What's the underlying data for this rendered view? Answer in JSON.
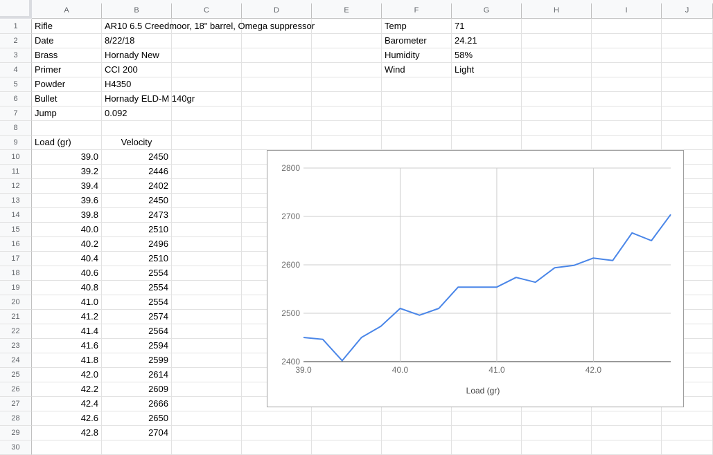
{
  "columns": [
    "A",
    "B",
    "C",
    "D",
    "E",
    "F",
    "G",
    "H",
    "I",
    "J"
  ],
  "rows": [
    "1",
    "2",
    "3",
    "4",
    "5",
    "6",
    "7",
    "8",
    "9",
    "10",
    "11",
    "12",
    "13",
    "14",
    "15",
    "16",
    "17",
    "18",
    "19",
    "20",
    "21",
    "22",
    "23",
    "24",
    "25",
    "26",
    "27",
    "28",
    "29",
    "30"
  ],
  "info": [
    {
      "label": "Rifle",
      "value": "AR10 6.5 Creedmoor, 18\" barrel, Omega suppressor"
    },
    {
      "label": "Date",
      "value": "8/22/18"
    },
    {
      "label": "Brass",
      "value": "Hornady New"
    },
    {
      "label": "Primer",
      "value": "CCI 200"
    },
    {
      "label": "Powder",
      "value": "H4350"
    },
    {
      "label": "Bullet",
      "value": "Hornady ELD-M 140gr"
    },
    {
      "label": "Jump",
      "value": "0.092"
    }
  ],
  "conditions": [
    {
      "label": "Temp",
      "value": "71"
    },
    {
      "label": "Barometer",
      "value": "24.21"
    },
    {
      "label": "Humidity",
      "value": "58%"
    },
    {
      "label": "Wind",
      "value": "Light"
    }
  ],
  "table": {
    "headers": [
      "Load (gr)",
      "Velocity"
    ],
    "rows": [
      [
        "39.0",
        "2450"
      ],
      [
        "39.2",
        "2446"
      ],
      [
        "39.4",
        "2402"
      ],
      [
        "39.6",
        "2450"
      ],
      [
        "39.8",
        "2473"
      ],
      [
        "40.0",
        "2510"
      ],
      [
        "40.2",
        "2496"
      ],
      [
        "40.4",
        "2510"
      ],
      [
        "40.6",
        "2554"
      ],
      [
        "40.8",
        "2554"
      ],
      [
        "41.0",
        "2554"
      ],
      [
        "41.2",
        "2574"
      ],
      [
        "41.4",
        "2564"
      ],
      [
        "41.6",
        "2594"
      ],
      [
        "41.8",
        "2599"
      ],
      [
        "42.0",
        "2614"
      ],
      [
        "42.2",
        "2609"
      ],
      [
        "42.4",
        "2666"
      ],
      [
        "42.6",
        "2650"
      ],
      [
        "42.8",
        "2704"
      ]
    ]
  },
  "chart_data": {
    "type": "line",
    "title": "",
    "xlabel": "Load (gr)",
    "ylabel": "",
    "x": [
      39.0,
      39.2,
      39.4,
      39.6,
      39.8,
      40.0,
      40.2,
      40.4,
      40.6,
      40.8,
      41.0,
      41.2,
      41.4,
      41.6,
      41.8,
      42.0,
      42.2,
      42.4,
      42.6,
      42.8
    ],
    "series": [
      {
        "values": [
          2450,
          2446,
          2402,
          2450,
          2473,
          2510,
          2496,
          2510,
          2554,
          2554,
          2554,
          2574,
          2564,
          2594,
          2599,
          2614,
          2609,
          2666,
          2650,
          2704
        ]
      }
    ],
    "xlim": [
      39.0,
      42.8
    ],
    "ylim": [
      2400,
      2800
    ],
    "xticks": [
      "39.0",
      "40.0",
      "41.0",
      "42.0"
    ],
    "yticks": [
      "2400",
      "2500",
      "2600",
      "2700",
      "2800"
    ],
    "grid": true,
    "line_color": "#4a86e8"
  }
}
